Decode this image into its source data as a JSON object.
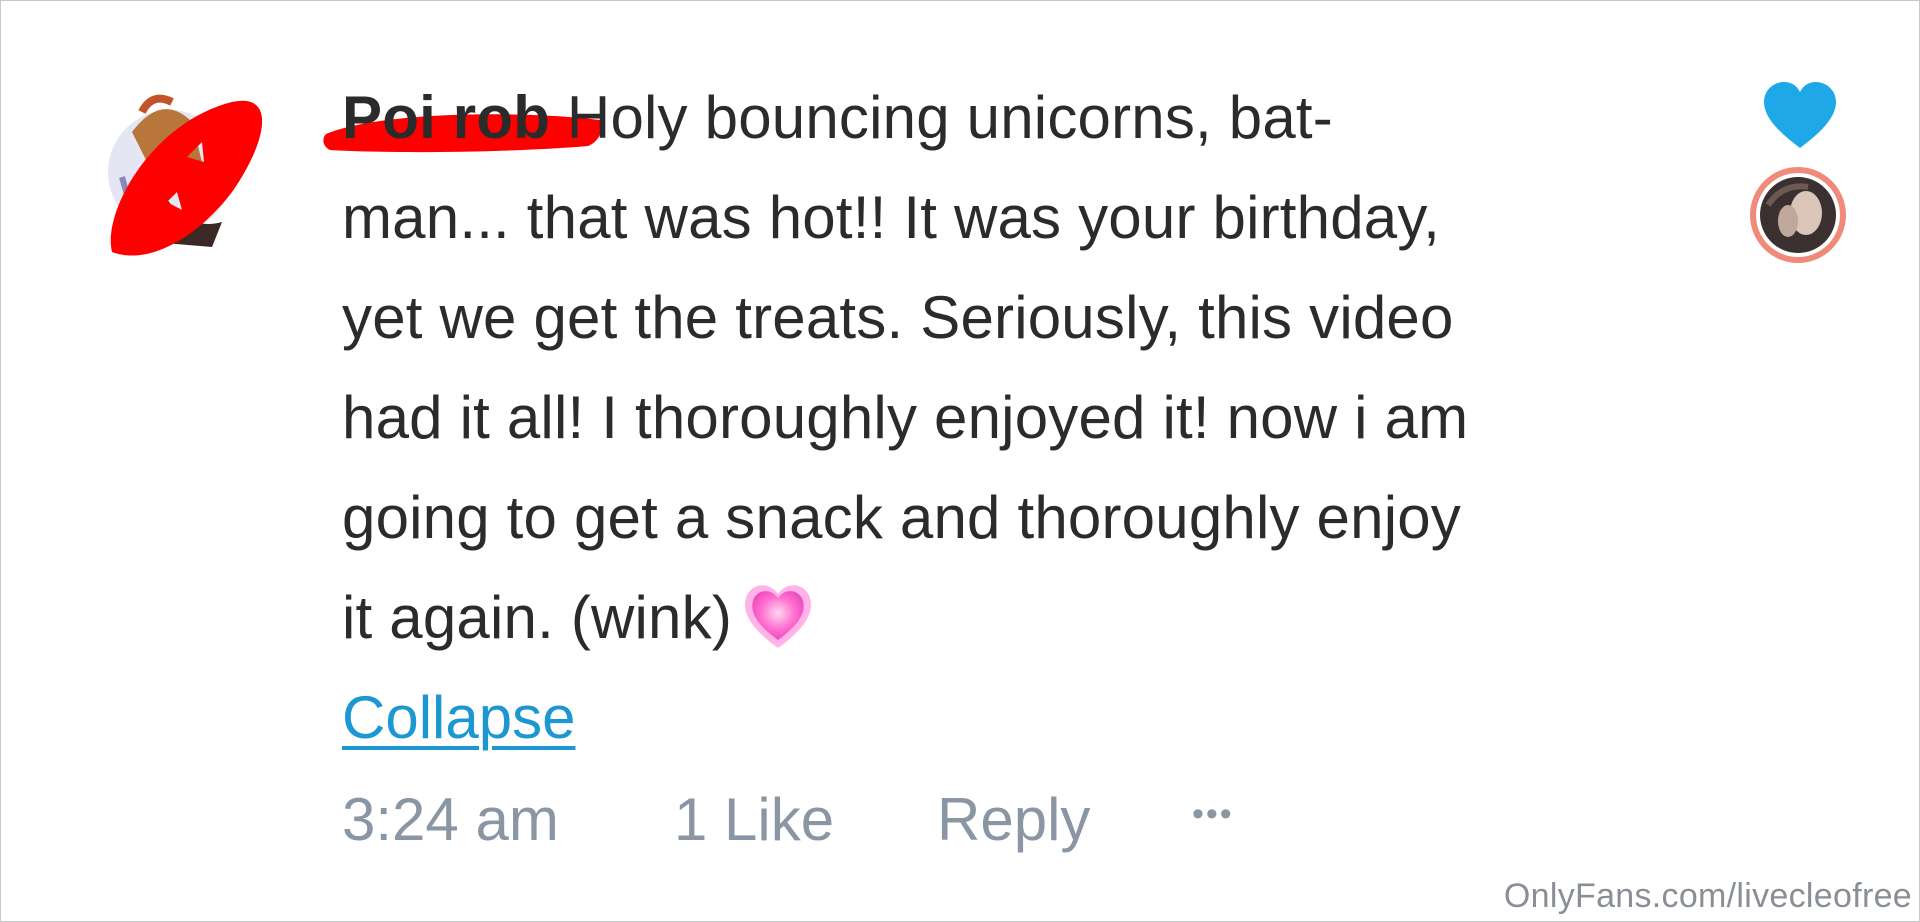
{
  "comment": {
    "author": "Poi rob",
    "lines": [
      " Holy bouncing unicorns, bat-",
      "man... that was hot!! It was your birthday,",
      "yet we get the treats. Seriously, this video",
      "had it all! I thoroughly enjoyed it! now i am",
      "going to get a snack and thoroughly enjoy",
      "it again. (wink)"
    ],
    "emoji": "growing-heart-emoji",
    "collapse_label": "Collapse",
    "timestamp": "3:24 am",
    "likes": "1 Like",
    "reply_label": "Reply",
    "more_label": "•••"
  },
  "actions": {
    "like_icon": "heart-icon",
    "like_color": "#1fa8e8"
  },
  "colors": {
    "text": "#2b2b2b",
    "link": "#1d97d1",
    "meta": "#8a96a3",
    "redaction": "#ff0000",
    "emoji_pink": "#ff5fc8"
  },
  "watermark": "OnlyFans.com/livecleofree"
}
